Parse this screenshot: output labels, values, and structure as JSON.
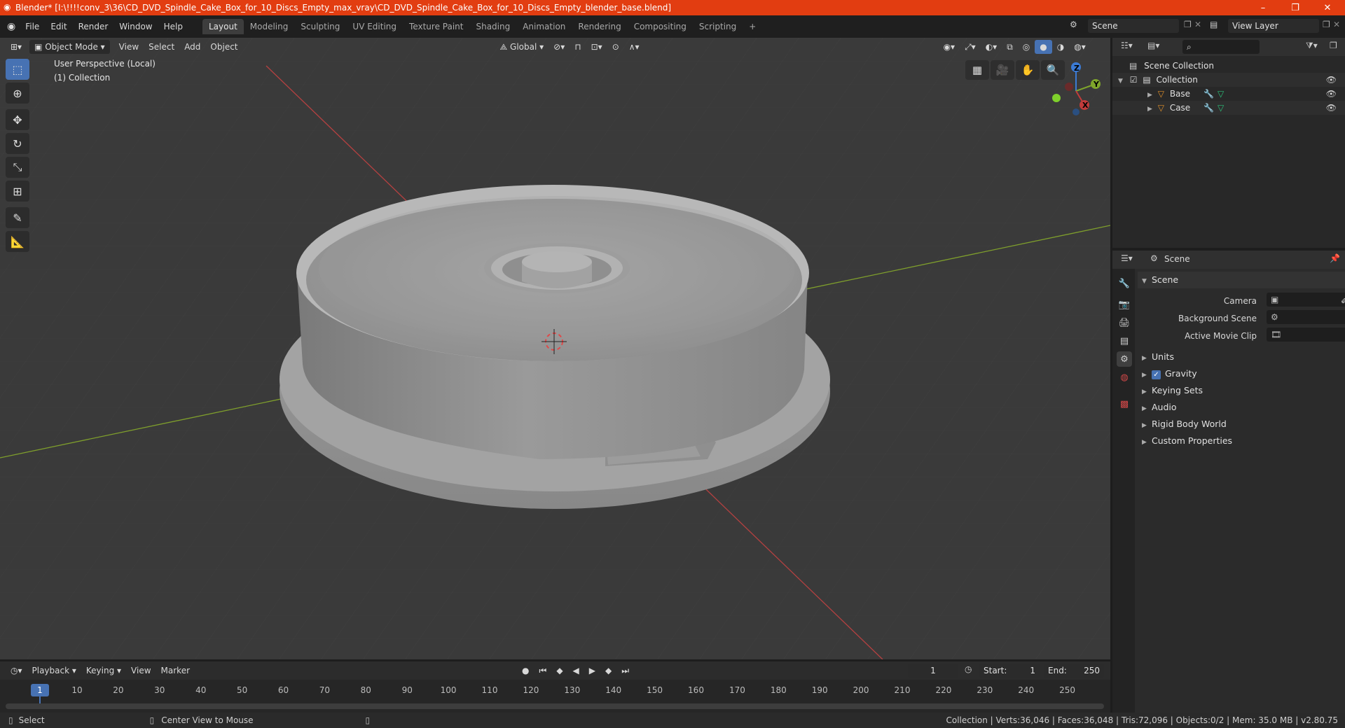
{
  "window": {
    "title": "Blender* [I:\\!!!!conv_3\\36\\CD_DVD_Spindle_Cake_Box_for_10_Discs_Empty_max_vray\\CD_DVD_Spindle_Cake_Box_for_10_Discs_Empty_blender_base.blend]",
    "controls": [
      "–",
      "❐",
      "✕"
    ]
  },
  "menu": [
    "File",
    "Edit",
    "Render",
    "Window",
    "Help"
  ],
  "workspaces": [
    "Layout",
    "Modeling",
    "Sculpting",
    "UV Editing",
    "Texture Paint",
    "Shading",
    "Animation",
    "Rendering",
    "Compositing",
    "Scripting",
    "+"
  ],
  "active_workspace": "Layout",
  "scene_selector": "Scene",
  "view_layer": "View Layer",
  "viewport_header": {
    "mode": "Object Mode",
    "menus": [
      "View",
      "Select",
      "Add",
      "Object"
    ],
    "transform_orientation": "Global"
  },
  "viewport": {
    "perspective_label": "User Perspective (Local)",
    "collection_label": "(1) Collection",
    "gizmo_axes": {
      "z": "Z",
      "y": "Y",
      "x": "X"
    }
  },
  "outliner": {
    "root": "Scene Collection",
    "collection": "Collection",
    "items": [
      "Base",
      "Case"
    ]
  },
  "properties": {
    "header": "Scene",
    "section": "Scene",
    "fields": [
      {
        "label": "Camera",
        "value": ""
      },
      {
        "label": "Background Scene",
        "value": ""
      },
      {
        "label": "Active Movie Clip",
        "value": ""
      }
    ],
    "panels": [
      "Units",
      "Gravity",
      "Keying Sets",
      "Audio",
      "Rigid Body World",
      "Custom Properties"
    ]
  },
  "timeline": {
    "menus": [
      "Playback",
      "Keying",
      "View",
      "Marker"
    ],
    "current_frame": "1",
    "start_label": "Start:",
    "start": "1",
    "end_label": "End:",
    "end": "250",
    "ticks": [
      "1",
      "10",
      "20",
      "30",
      "40",
      "50",
      "60",
      "70",
      "80",
      "90",
      "100",
      "110",
      "120",
      "130",
      "140",
      "150",
      "160",
      "170",
      "180",
      "190",
      "200",
      "210",
      "220",
      "230",
      "240",
      "250"
    ]
  },
  "statusbar": {
    "left": "Select",
    "middle": "Center View to Mouse",
    "right": "Collection | Verts:36,046 | Faces:36,048 | Tris:72,096 | Objects:0/2 | Mem: 35.0 MB | v2.80.75"
  },
  "colors": {
    "titlebar": "#e23d11",
    "accent": "#4772b3",
    "viewport_bg": "#3a3a3a",
    "x_axis": "#c23b3b",
    "y_axis": "#7fa62b",
    "z_axis": "#3b7bd6"
  }
}
